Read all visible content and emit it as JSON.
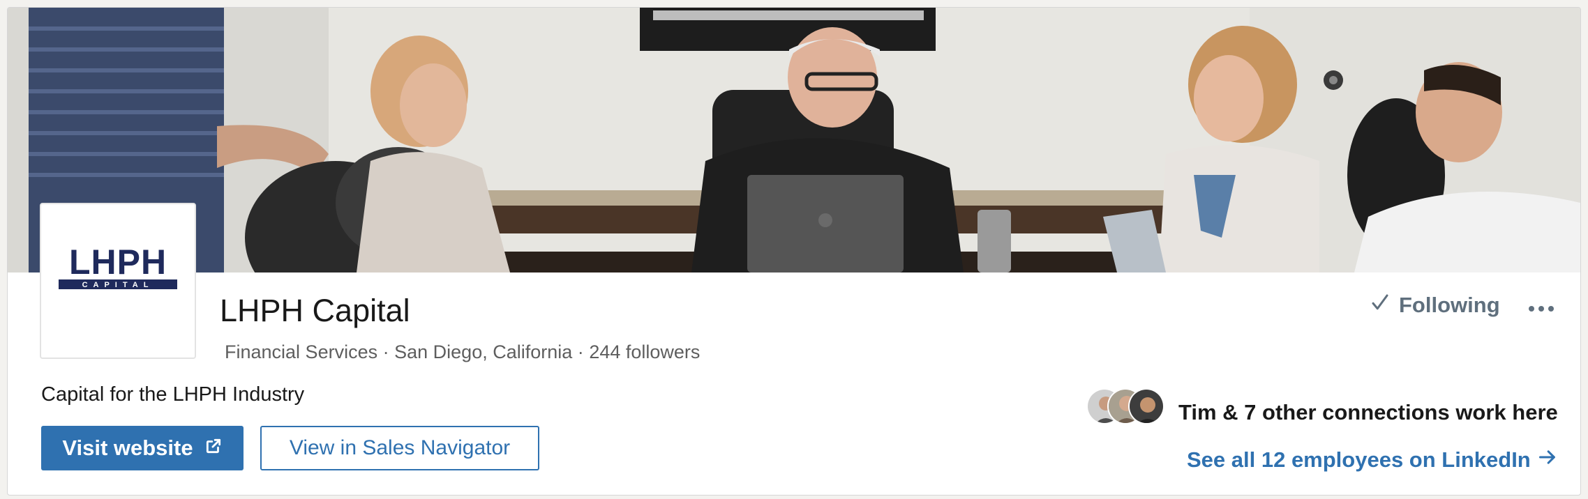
{
  "company": {
    "name": "LHPH Capital",
    "industry": "Financial Services",
    "location": "San Diego, California",
    "followers": "244 followers",
    "separator": "·",
    "tagline": "Capital for the LHPH Industry",
    "logo_text": "LHPH",
    "logo_subtext": "CAPITAL"
  },
  "actions": {
    "visit_website": "Visit website",
    "sales_navigator": "View in Sales Navigator",
    "following": "Following"
  },
  "connections": {
    "text": "Tim & 7 other connections work here",
    "employees_link": "See all 12 employees on LinkedIn"
  },
  "icons": {
    "external_link": "external-link-icon",
    "check": "check-icon",
    "more": "more-horizontal-icon",
    "arrow": "arrow-right-icon"
  },
  "colors": {
    "brand_blue": "#2f71b0",
    "logo_navy": "#1f2a5c",
    "muted_text": "#5e5e5e",
    "following_gray": "#5f6f7d"
  }
}
